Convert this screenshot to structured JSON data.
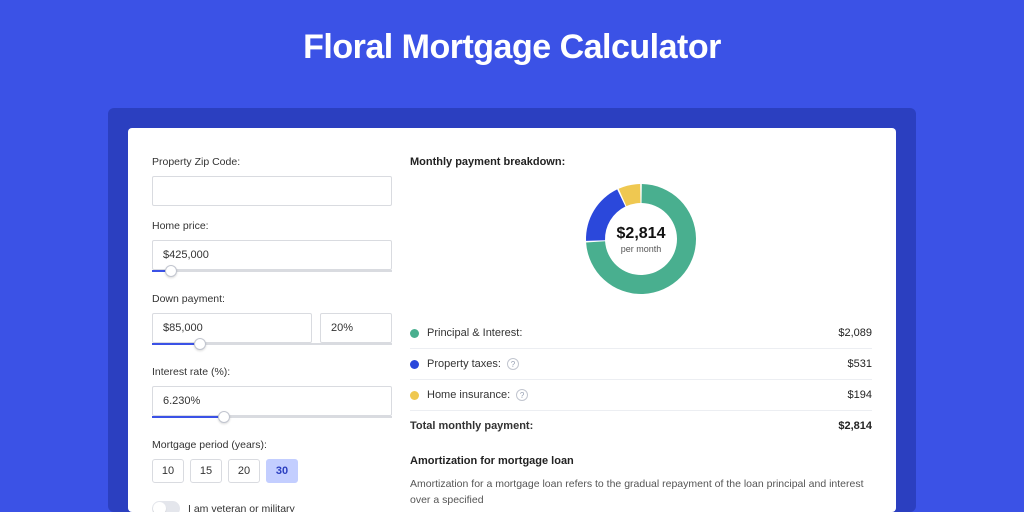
{
  "title": "Floral Mortgage Calculator",
  "form": {
    "zip": {
      "label": "Property Zip Code:",
      "value": ""
    },
    "home_price": {
      "label": "Home price:",
      "value": "$425,000",
      "slider_pct": 8
    },
    "down_payment": {
      "label": "Down payment:",
      "value": "$85,000",
      "pct_value": "20%",
      "slider_pct": 20
    },
    "interest_rate": {
      "label": "Interest rate (%):",
      "value": "6.230%",
      "slider_pct": 30
    },
    "mortgage_period": {
      "label": "Mortgage period (years):",
      "options": [
        "10",
        "15",
        "20",
        "30"
      ],
      "selected": "30"
    },
    "veteran": {
      "label": "I am veteran or military",
      "checked": false
    }
  },
  "breakdown": {
    "title": "Monthly payment breakdown:",
    "amount": "$2,814",
    "amount_sub": "per month",
    "items": [
      {
        "label": "Principal & Interest:",
        "amount": "$2,089",
        "color": "#49af8f",
        "info": false
      },
      {
        "label": "Property taxes:",
        "amount": "$531",
        "color": "#2b48db",
        "info": true
      },
      {
        "label": "Home insurance:",
        "amount": "$194",
        "color": "#efc851",
        "info": true
      }
    ],
    "total_label": "Total monthly payment:",
    "total_amount": "$2,814"
  },
  "amort": {
    "title": "Amortization for mortgage loan",
    "text": "Amortization for a mortgage loan refers to the gradual repayment of the loan principal and interest over a specified"
  },
  "chart_data": {
    "type": "pie",
    "title": "Monthly payment breakdown",
    "series": [
      {
        "name": "Principal & Interest",
        "value": 2089,
        "color": "#49af8f"
      },
      {
        "name": "Property taxes",
        "value": 531,
        "color": "#2b48db"
      },
      {
        "name": "Home insurance",
        "value": 194,
        "color": "#efc851"
      }
    ],
    "total": 2814
  }
}
